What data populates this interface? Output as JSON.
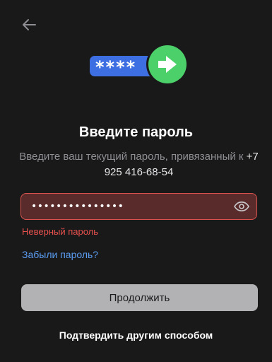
{
  "header": {
    "back_icon": "arrow-left-icon"
  },
  "hero": {
    "mask": "****",
    "arrow_icon": "arrow-right-icon",
    "colors": {
      "pill": "#3d6fe3",
      "circle": "#4cd06a"
    }
  },
  "title": "Введите пароль",
  "subtitle": {
    "text": "Введите ваш текущий пароль, привязанный к",
    "phone": "+7 925 416-68-54"
  },
  "password_field": {
    "value": "•••••••••••••••",
    "toggle_icon": "eye-icon"
  },
  "error_text": "Неверный пароль",
  "forgot_link": "Забыли пароль?",
  "continue_button": "Продолжить",
  "alt_button": "Подтвердить другим способом",
  "colors": {
    "background": "#19191a",
    "error": "#e8514d",
    "link": "#5b9cf0",
    "button": "#b2b2b4"
  }
}
